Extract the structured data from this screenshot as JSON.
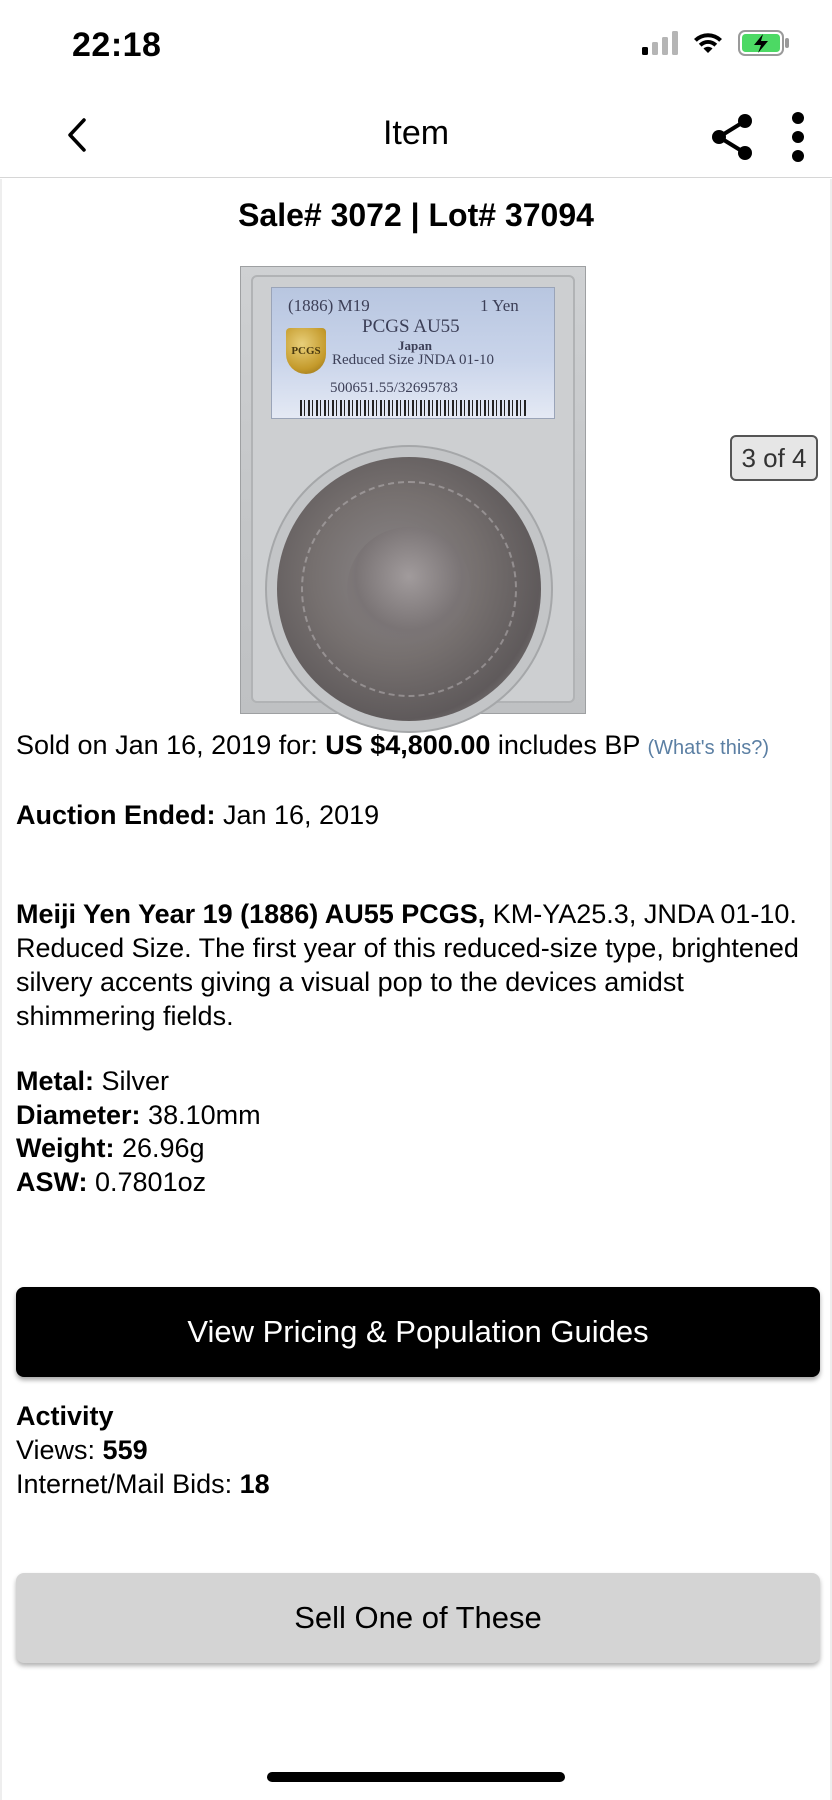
{
  "status_bar": {
    "time": "22:18",
    "icons": [
      "signal-icon",
      "wifi-icon",
      "battery-charging-icon"
    ],
    "battery_color": "#4cd964"
  },
  "nav": {
    "title": "Item",
    "back_icon": "chevron-left-icon",
    "share_icon": "share-icon",
    "more_icon": "more-vertical-icon"
  },
  "sale": {
    "header": "Sale# 3072 | Lot# 37094"
  },
  "gallery": {
    "counter": "3 of 4",
    "slab_label": {
      "line1_left": "(1886) M19",
      "line1_right": "1 Yen",
      "grade": "PCGS AU55",
      "country": "Japan",
      "variety": "Reduced Size JNDA 01-10",
      "cert": "500651.55/32695783",
      "logo": "PCGS"
    }
  },
  "price": {
    "sold_prefix": "Sold on Jan 16, 2019 for: ",
    "amount": "US $4,800.00",
    "suffix": " includes BP ",
    "whats_this": "(What's this?)",
    "link_color": "#5b7fa3"
  },
  "auction": {
    "ended_label": "Auction Ended:",
    "ended_value": " Jan 16, 2019"
  },
  "description": {
    "title": "Meiji Yen Year 19 (1886) AU55 PCGS,",
    "body": " KM-YA25.3, JNDA 01-10. Reduced Size. The first year of this reduced-size type, brightened silvery accents giving a visual pop to the devices amidst shimmering fields."
  },
  "specs": [
    {
      "label": "Metal:",
      "value": " Silver"
    },
    {
      "label": "Diameter:",
      "value": " 38.10mm"
    },
    {
      "label": "Weight:",
      "value": " 26.96g"
    },
    {
      "label": "ASW:",
      "value": " 0.7801oz"
    }
  ],
  "buttons": {
    "pricing": "View Pricing & Population Guides",
    "sell": "Sell One of These"
  },
  "activity": {
    "title": "Activity",
    "views_label": "Views: ",
    "views_value": "559",
    "bids_label": "Internet/Mail Bids: ",
    "bids_value": "18"
  }
}
